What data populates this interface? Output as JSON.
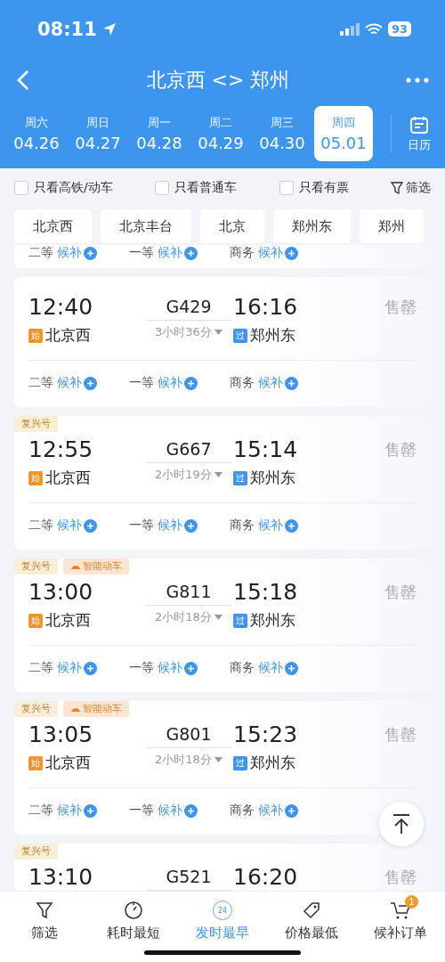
{
  "status_bar": {
    "time": "08:11",
    "battery": "93"
  },
  "nav": {
    "title": "北京西 <> 郑州"
  },
  "dates": [
    {
      "weekday": "周六",
      "date": "04.26",
      "selected": false
    },
    {
      "weekday": "周日",
      "date": "04.27",
      "selected": false
    },
    {
      "weekday": "周一",
      "date": "04.28",
      "selected": false
    },
    {
      "weekday": "周二",
      "date": "04.29",
      "selected": false
    },
    {
      "weekday": "周三",
      "date": "04.30",
      "selected": false
    },
    {
      "weekday": "周四",
      "date": "05.01",
      "selected": true
    }
  ],
  "calendar_label": "日历",
  "filters": [
    {
      "label": "只看高铁/动车",
      "checked": false
    },
    {
      "label": "只看普通车",
      "checked": false
    },
    {
      "label": "只看有票",
      "checked": false
    }
  ],
  "filter_button": "筛选",
  "stations": [
    "北京西",
    "北京丰台",
    "北京",
    "郑州东",
    "郑州"
  ],
  "partial_card": {
    "seats": [
      {
        "class": "二等",
        "status": "候补"
      },
      {
        "class": "一等",
        "status": "候补"
      },
      {
        "class": "商务",
        "status": "候补"
      }
    ]
  },
  "trains": [
    {
      "depart": "12:40",
      "train": "G429",
      "arrive": "16:16",
      "duration": "3小时36分",
      "from": {
        "badge": "始",
        "kind": "origin",
        "name": "北京西"
      },
      "to": {
        "badge": "过",
        "kind": "pass",
        "name": "郑州东"
      },
      "availability": "售罄",
      "seats": [
        {
          "class": "二等",
          "status": "候补"
        },
        {
          "class": "一等",
          "status": "候补"
        },
        {
          "class": "商务",
          "status": "候补"
        }
      ]
    },
    {
      "tags": [
        {
          "label": "复兴号",
          "kind": "fuxing"
        }
      ],
      "depart": "12:55",
      "train": "G667",
      "arrive": "15:14",
      "duration": "2小时19分",
      "from": {
        "badge": "始",
        "kind": "origin",
        "name": "北京西"
      },
      "to": {
        "badge": "过",
        "kind": "pass",
        "name": "郑州东"
      },
      "availability": "售罄",
      "seats": [
        {
          "class": "二等",
          "status": "候补"
        },
        {
          "class": "一等",
          "status": "候补"
        },
        {
          "class": "商务",
          "status": "候补"
        }
      ]
    },
    {
      "tags": [
        {
          "label": "复兴号",
          "kind": "fuxing"
        },
        {
          "label": "智能动车",
          "kind": "smart"
        }
      ],
      "depart": "13:00",
      "train": "G811",
      "arrive": "15:18",
      "duration": "2小时18分",
      "from": {
        "badge": "始",
        "kind": "origin",
        "name": "北京西"
      },
      "to": {
        "badge": "过",
        "kind": "pass",
        "name": "郑州东"
      },
      "availability": "售罄",
      "seats": [
        {
          "class": "二等",
          "status": "候补"
        },
        {
          "class": "一等",
          "status": "候补"
        },
        {
          "class": "商务",
          "status": "候补"
        }
      ]
    },
    {
      "tags": [
        {
          "label": "复兴号",
          "kind": "fuxing"
        },
        {
          "label": "智能动车",
          "kind": "smart"
        }
      ],
      "depart": "13:05",
      "train": "G801",
      "arrive": "15:23",
      "duration": "2小时18分",
      "from": {
        "badge": "始",
        "kind": "origin",
        "name": "北京西"
      },
      "to": {
        "badge": "过",
        "kind": "pass",
        "name": "郑州东"
      },
      "availability": "售罄",
      "seats": [
        {
          "class": "二等",
          "status": "候补"
        },
        {
          "class": "一等",
          "status": "候补"
        },
        {
          "class": "商务",
          "status": "候补"
        }
      ]
    },
    {
      "tags": [
        {
          "label": "复兴号",
          "kind": "fuxing"
        }
      ],
      "depart": "13:10",
      "train": "G521",
      "arrive": "16:20",
      "availability": "售罄"
    }
  ],
  "bottom_tabs": [
    {
      "label": "筛选",
      "kind": "filter",
      "selected": false
    },
    {
      "label": "耗时最短",
      "kind": "timer",
      "selected": false
    },
    {
      "label": "发时最早",
      "kind": "clock",
      "icon_text": "24",
      "selected": true
    },
    {
      "label": "价格最低",
      "kind": "price",
      "selected": false
    },
    {
      "label": "候补订单",
      "kind": "cart",
      "count": "1",
      "selected": false
    }
  ]
}
